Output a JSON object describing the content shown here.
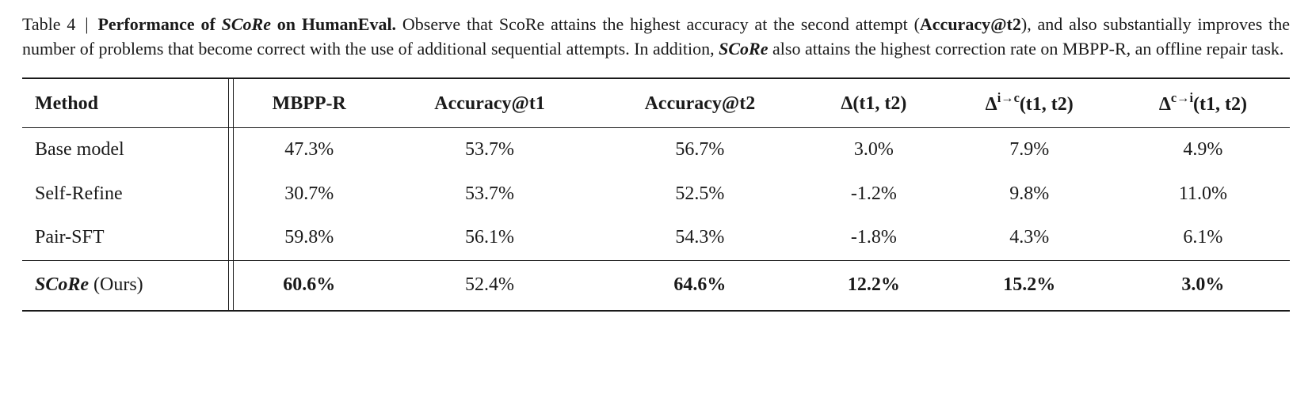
{
  "caption": {
    "table_label": "Table 4",
    "separator": "|",
    "title_prefix": "Performance of ",
    "title_model": "SCoRe",
    "title_suffix": " on HumanEval.",
    "body_1": " Observe that ScoRe attains the highest accuracy at the second attempt (",
    "acc_t2": "Accuracy@t2",
    "body_2": "), and also substantially improves the number of problems that become correct with the use of additional sequential attempts. In addition, ",
    "model_again": "SCoRe",
    "body_3": " also attains the highest correction rate on MBPP-R, an offline repair task."
  },
  "chart_data": {
    "type": "table",
    "headers": {
      "method": "Method",
      "mbpp_r": "MBPP-R",
      "acc_t1": "Accuracy@t1",
      "acc_t2": "Accuracy@t2",
      "delta": "Δ(t1, t2)",
      "delta_ic_sup": "i→c",
      "delta_ic_rest": "(t1, t2)",
      "delta_ci_sup": "c→i",
      "delta_ci_rest": "(t1, t2)"
    },
    "rows": [
      {
        "method": "Base model",
        "mbpp_r": "47.3%",
        "acc_t1": "53.7%",
        "acc_t2": "56.7%",
        "delta": "3.0%",
        "delta_ic": "7.9%",
        "delta_ci": "4.9%",
        "bold": {
          "mbpp_r": false,
          "acc_t2": false,
          "delta": false,
          "delta_ic": false,
          "delta_ci": false
        },
        "method_italic": false
      },
      {
        "method": "Self-Refine",
        "mbpp_r": "30.7%",
        "acc_t1": "53.7%",
        "acc_t2": "52.5%",
        "delta": "-1.2%",
        "delta_ic": "9.8%",
        "delta_ci": "11.0%",
        "bold": {
          "mbpp_r": false,
          "acc_t2": false,
          "delta": false,
          "delta_ic": false,
          "delta_ci": false
        },
        "method_italic": false
      },
      {
        "method": "Pair-SFT",
        "mbpp_r": "59.8%",
        "acc_t1": "56.1%",
        "acc_t2": "54.3%",
        "delta": "-1.8%",
        "delta_ic": "4.3%",
        "delta_ci": "6.1%",
        "bold": {
          "mbpp_r": false,
          "acc_t2": false,
          "delta": false,
          "delta_ic": false,
          "delta_ci": false
        },
        "method_italic": false
      },
      {
        "method_name": "SCoRe",
        "method_suffix": " (Ours)",
        "mbpp_r": "60.6%",
        "acc_t1": "52.4%",
        "acc_t2": "64.6%",
        "delta": "12.2%",
        "delta_ic": "15.2%",
        "delta_ci": "3.0%",
        "bold": {
          "mbpp_r": true,
          "acc_t2": true,
          "delta": true,
          "delta_ic": true,
          "delta_ci": true
        },
        "method_italic": true
      }
    ]
  }
}
